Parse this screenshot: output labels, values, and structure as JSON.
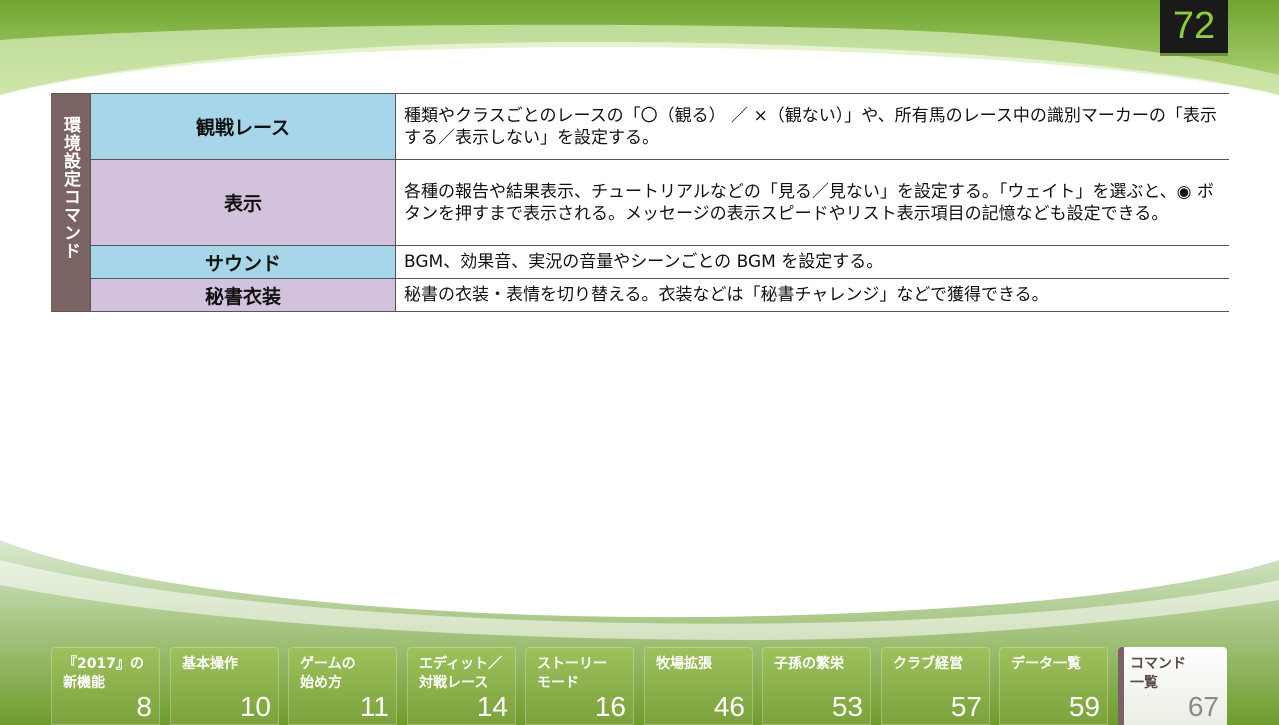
{
  "page_number": "72",
  "table": {
    "group_label": "環境設定コマンド",
    "rows": [
      {
        "name": "観戦レース",
        "description": "種類やクラスごとのレースの「〇（観る） ／ ×（観ない）」や、所有馬のレース中の識別マーカーの「表示する／表示しない」を設定する。",
        "color": "#a7d6ea"
      },
      {
        "name": "表示",
        "description": "各種の報告や結果表示、チュートリアルなどの「見る／見ない」を設定する。「ウェイト」を選ぶと、◉ ボタンを押すまで表示される。メッセージの表示スピードやリスト表示項目の記憶なども設定できる。",
        "color": "#d2c2de"
      },
      {
        "name": "サウンド",
        "description": "BGM、効果音、実況の音量やシーンごとの BGM を設定する。",
        "color": "#a7d6ea"
      },
      {
        "name": "秘書衣装",
        "description": "秘書の衣装・表情を切り替える。衣装などは「秘書チャレンジ」などで獲得できる。",
        "color": "#d2c2de"
      }
    ]
  },
  "tabs": [
    {
      "label": "『2017』の\n新機能",
      "page": "8"
    },
    {
      "label": "基本操作",
      "page": "10"
    },
    {
      "label": "ゲームの\n始め方",
      "page": "11"
    },
    {
      "label": "エディット／\n対戦レース",
      "page": "14"
    },
    {
      "label": "ストーリー\nモード",
      "page": "16"
    },
    {
      "label": "牧場拡張",
      "page": "46"
    },
    {
      "label": "子孫の繁栄",
      "page": "53"
    },
    {
      "label": "クラブ経営",
      "page": "57"
    },
    {
      "label": "データ一覧",
      "page": "59"
    },
    {
      "label": "コマンド\n一覧",
      "page": "67"
    }
  ],
  "colors": {
    "accent_green": "#8fce3a",
    "group_brown": "#7a6362",
    "row_blue": "#a7d6ea",
    "row_purple": "#d2c2de"
  }
}
